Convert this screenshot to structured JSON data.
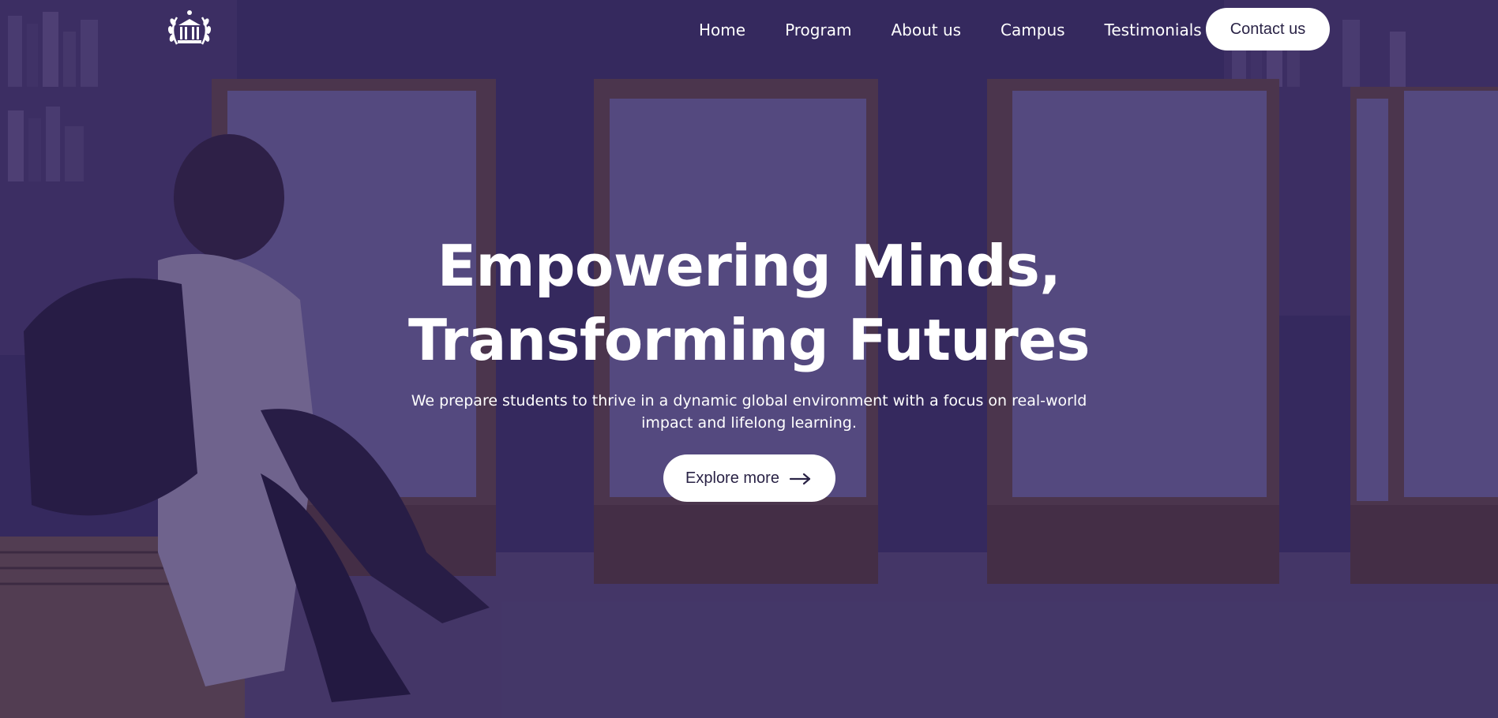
{
  "nav": {
    "logo_icon": "university-laurel-logo-icon",
    "links": [
      {
        "label": "Home"
      },
      {
        "label": "Program"
      },
      {
        "label": "About us"
      },
      {
        "label": "Campus"
      },
      {
        "label": "Testimonials"
      }
    ],
    "contact_label": "Contact us"
  },
  "hero": {
    "headline_line1": "Empowering Minds,",
    "headline_line2": "Transforming Futures",
    "subtext": "We prepare students to thrive in a dynamic global environment with a focus on real-world impact and lifelong learning.",
    "cta_label": "Explore more",
    "cta_icon": "arrow-right-icon"
  },
  "colors": {
    "overlay": "#241852",
    "button_bg": "#ffffff",
    "button_text": "#2a2346",
    "text": "#ffffff"
  }
}
